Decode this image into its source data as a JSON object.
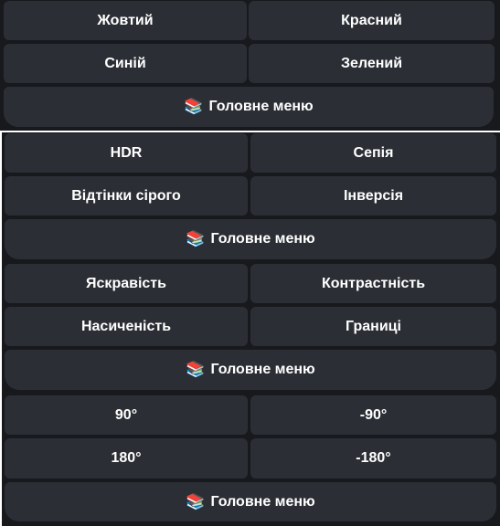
{
  "color_menu": {
    "buttons": [
      "Жовтий",
      "Красний",
      "Синій",
      "Зелений"
    ],
    "main_menu": "Головне меню"
  },
  "filter_menu": {
    "buttons": [
      "HDR",
      "Сепія",
      "Відтінки сірого",
      "Інверсія"
    ],
    "main_menu": "Головне меню"
  },
  "adjust_menu": {
    "buttons": [
      "Яскравість",
      "Контрастність",
      "Насиченість",
      "Границі"
    ],
    "main_menu": "Головне меню"
  },
  "rotate_menu": {
    "buttons": [
      "90°",
      "-90°",
      "180°",
      "-180°"
    ],
    "main_menu": "Головне меню"
  },
  "main_menu_icon": "📚",
  "colors": {
    "panel_bg": "#17191d",
    "button_bg": "#2b2f35",
    "text": "#ffffff"
  }
}
